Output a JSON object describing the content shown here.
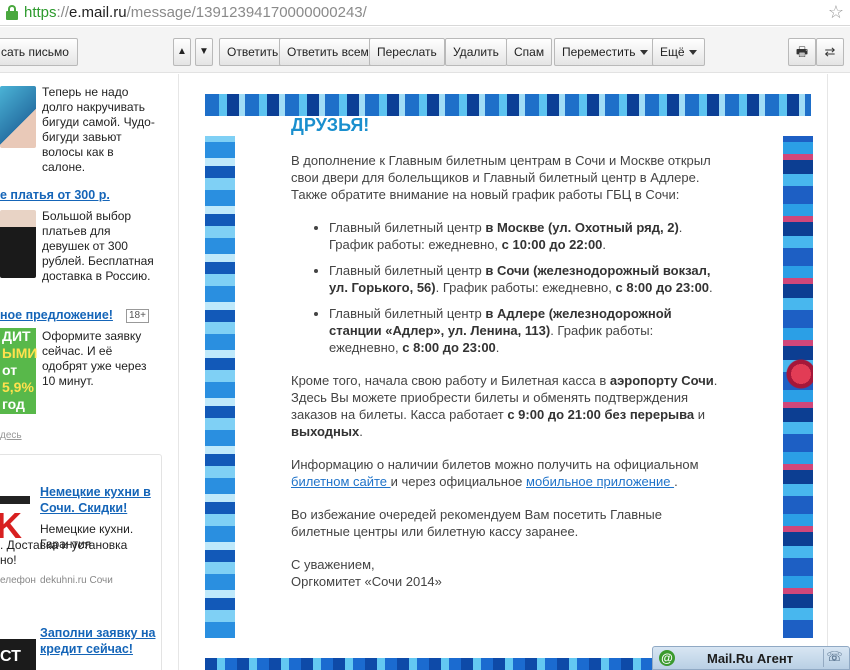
{
  "browser": {
    "url_scheme": "https",
    "url_sep": "://",
    "url_host": "e.mail.ru",
    "url_path": "/message/13912394170000000243/"
  },
  "toolbar": {
    "compose": "сать письмо",
    "up": "▲",
    "down": "▼",
    "reply": "Ответить",
    "reply_all": "Ответить всем",
    "forward": "Переслать",
    "delete": "Удалить",
    "spam": "Спам",
    "move": "Переместить",
    "more": "Ещё"
  },
  "sidebar": {
    "ad1_text": "Теперь не надо долго накручивать бигуди самой. Чудо-бигуди завьют волосы как в салоне.",
    "ad2_title": "е платья от 300 р.",
    "ad2_text": "Большой выбор платьев для девушек от 300 рублей. Бесплатная доставка в Россию.",
    "ad3_title": "ное предложение!",
    "ad3_age": "18+",
    "ad3_text": "Оформите заявку сейчас. И её одобрят уже через 10 минут.",
    "ad3_banner": [
      "ДИТ",
      "ЫМИ",
      "от",
      "5,9%",
      "год"
    ],
    "ads_link": "десь",
    "ad4_title": "Немецкие кухни в Сочи. Скидки!",
    "ad4_text1": "Немецкие кухни. Гарантия",
    "ad4_text2": ". Доставка и установка",
    "ad4_text3": "но!",
    "ad4_meta1": "елефон",
    "ad4_meta2": "dekuhni.ru Сочи",
    "ad5_title": "Заполни заявку на кредит сейчас!",
    "ad5_thumb": "СТ"
  },
  "email": {
    "greeting": "ДРУЗЬЯ!",
    "p1": "В дополнение к Главным билетным центрам в Сочи и Москве открыл свои двери для болельщиков и Главный билетный центр в Адлере. Также обратите внимание на новый график работы ГБЦ в Сочи:",
    "item1": {
      "a": "Главный билетный центр ",
      "b": "в Москве (ул. Охотный ряд, 2)",
      "c": ". График работы: ежедневно, ",
      "d": "с 10:00 до 22:00",
      "e": "."
    },
    "item2": {
      "a": "Главный билетный центр ",
      "b": "в Сочи (железнодорожный вокзал, ул. Горького, 56)",
      "c": ". График работы: ежедневно, ",
      "d": "с 8:00 до 23:00",
      "e": "."
    },
    "item3": {
      "a": "Главный билетный центр ",
      "b": "в Адлере (железнодорожной станции «Адлер», ул. Ленина, 113)",
      "c": ". График работы: ежедневно, ",
      "d": "с 8:00 до 23:00",
      "e": "."
    },
    "p2": {
      "a": "Кроме того, начала свою работу и Билетная касса в ",
      "b": "аэропорту Сочи",
      "c": ". Здесь Вы можете приобрести билеты и обменять подтверждения заказов на билеты. Касса работает ",
      "d": "с 9:00 до 21:00 без перерыва",
      "e": " и ",
      "f": "выходных",
      "g": "."
    },
    "p3": {
      "a": "Информацию о наличии билетов можно получить на официальном ",
      "link1": "билетном сайте ",
      "b": " и через официальное ",
      "link2": "мобильное приложение ",
      "c": "."
    },
    "p4": "Во избежание очередей рекомендуем Вам посетить Главные билетные центры или билетную кассу заранее.",
    "sign1": "С уважением,",
    "sign2": "Оргкомитет «Сочи 2014»"
  },
  "agent": {
    "title": "Mail.Ru Агент"
  },
  "colors": {
    "link": "#1f73c9",
    "greeting": "#1a8fce",
    "secure": "#4aa83f"
  }
}
